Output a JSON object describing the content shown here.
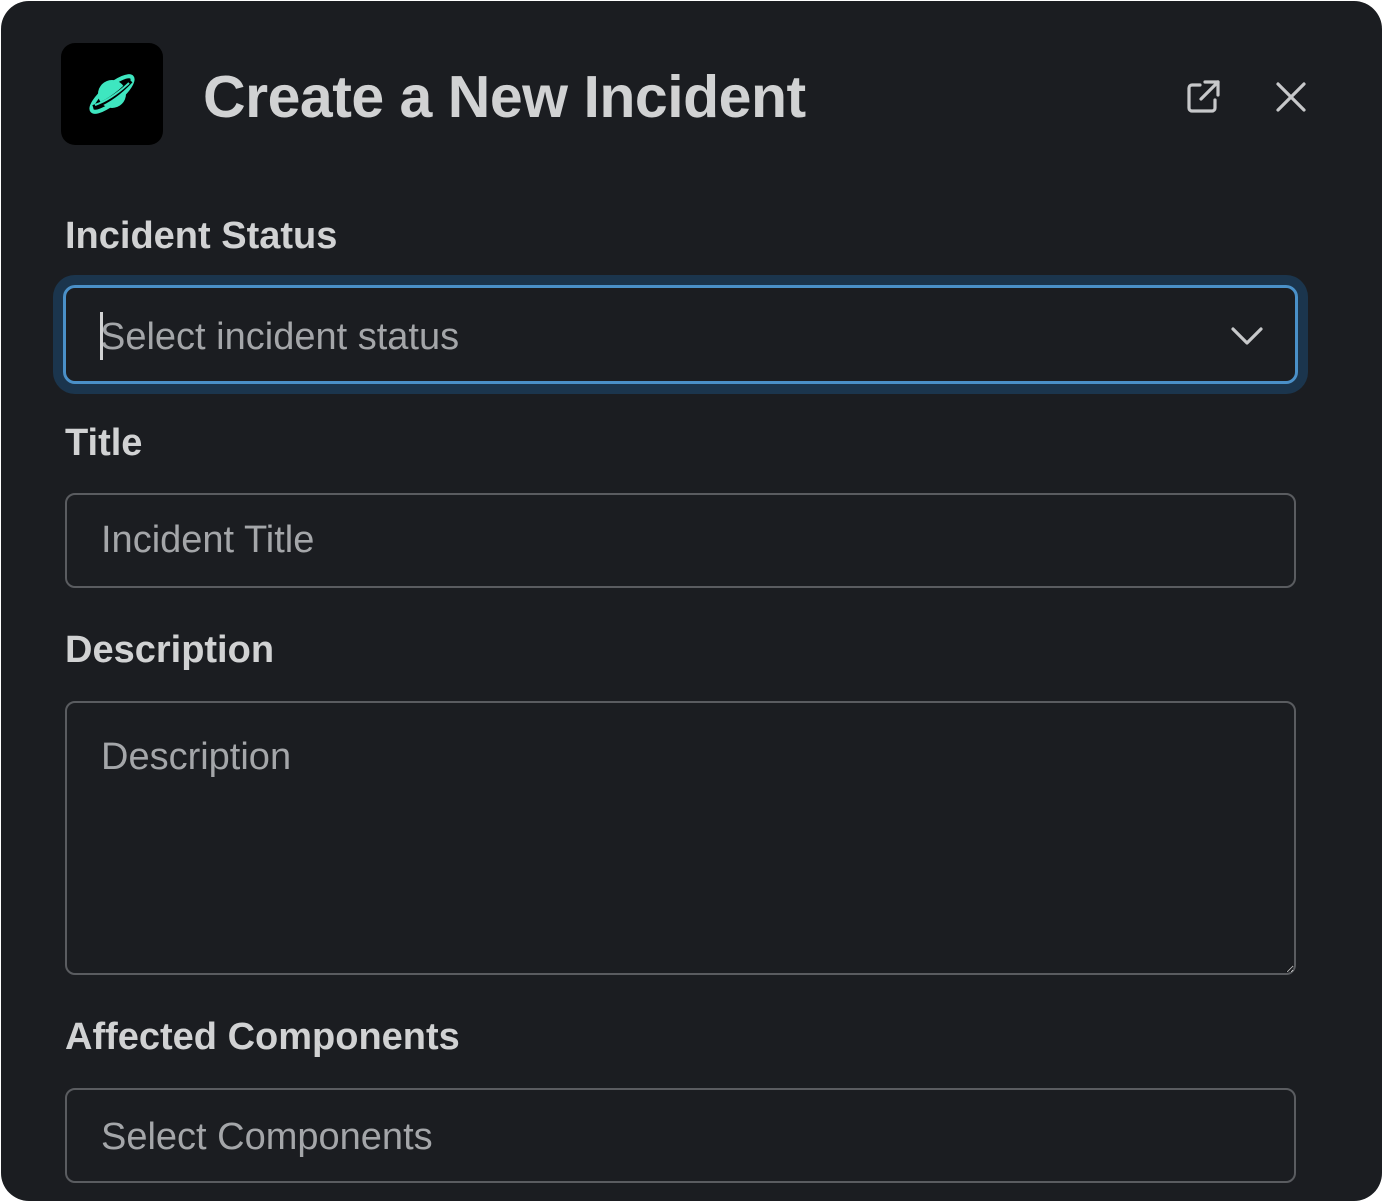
{
  "modal": {
    "title": "Create a New Incident",
    "app_icon": "planet-icon",
    "accent_color": "#3ee6c0",
    "focus_color": "#4a90c8"
  },
  "header_actions": {
    "popout_icon": "external-link-icon",
    "close_icon": "close-icon"
  },
  "form": {
    "status": {
      "label": "Incident Status",
      "placeholder": "Select incident status",
      "icon": "chevron-down-icon"
    },
    "title_field": {
      "label": "Title",
      "placeholder": "Incident Title",
      "value": ""
    },
    "description": {
      "label": "Description",
      "placeholder": "Description",
      "value": ""
    },
    "components": {
      "label": "Affected Components",
      "placeholder": "Select Components"
    }
  }
}
